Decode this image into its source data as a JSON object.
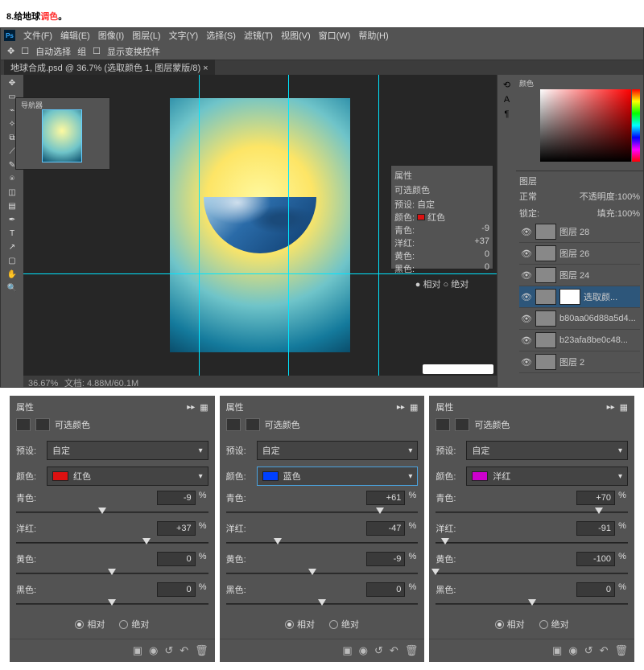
{
  "title": {
    "num": "8.",
    "text": "给地球",
    "red": "调色",
    "dot": "。"
  },
  "menu": [
    "文件(F)",
    "编辑(E)",
    "图像(I)",
    "图层(L)",
    "文字(Y)",
    "选择(S)",
    "滤镜(T)",
    "视图(V)",
    "窗口(W)",
    "帮助(H)"
  ],
  "optbar": {
    "tool": "自动选择",
    "group": "组",
    "checkbox": "显示变换控件"
  },
  "doc_tab": "地球合成.psd @ 36.7% (选取颜色 1, 图层蒙版/8) ×",
  "status": {
    "zoom": "36.67%",
    "info": "文档: 4.88M/60.1M"
  },
  "nav_title": "导航器",
  "float": {
    "title": "属性",
    "type": "可选颜色",
    "preset_l": "预设:",
    "preset_v": "自定",
    "color_l": "颜色:",
    "color_v": "红色",
    "rows": [
      {
        "l": "青色:",
        "v": "-9"
      },
      {
        "l": "洋红:",
        "v": "+37"
      },
      {
        "l": "黄色:",
        "v": "0"
      },
      {
        "l": "黑色:",
        "v": "0"
      }
    ],
    "rel": "相对",
    "abs": "绝对"
  },
  "color_tab": "颜色",
  "layers": {
    "tab": "图层",
    "kind": "正常",
    "opacity_l": "不透明度:",
    "opacity_v": "100%",
    "lock_l": "锁定:",
    "fill_l": "填充:",
    "fill_v": "100%",
    "items": [
      {
        "name": "图层 28"
      },
      {
        "name": "图层 26"
      },
      {
        "name": "图层 24"
      },
      {
        "name": "选取颜..."
      },
      {
        "name": ""
      },
      {
        "name": "b80aa06d88a5d4..."
      },
      {
        "name": "b23afa8be0c48..."
      },
      {
        "name": "图层 2"
      }
    ]
  },
  "panels": [
    {
      "title": "属性",
      "type": "可选颜色",
      "preset_l": "预设:",
      "preset_v": "自定",
      "color_l": "颜色:",
      "color_v": "红色",
      "color_hex": "#d11",
      "sliders": [
        {
          "l": "青色:",
          "v": "-9",
          "pos": 45
        },
        {
          "l": "洋红:",
          "v": "+37",
          "pos": 68
        },
        {
          "l": "黄色:",
          "v": "0",
          "pos": 50
        },
        {
          "l": "黑色:",
          "v": "0",
          "pos": 50
        }
      ],
      "rel": "相对",
      "abs": "绝对"
    },
    {
      "title": "属性",
      "type": "可选颜色",
      "preset_l": "预设:",
      "preset_v": "自定",
      "color_l": "颜色:",
      "color_v": "蓝色",
      "color_hex": "#0040ff",
      "sliders": [
        {
          "l": "青色:",
          "v": "+61",
          "pos": 80
        },
        {
          "l": "洋红:",
          "v": "-47",
          "pos": 27
        },
        {
          "l": "黄色:",
          "v": "-9",
          "pos": 45
        },
        {
          "l": "黑色:",
          "v": "0",
          "pos": 50
        }
      ],
      "rel": "相对",
      "abs": "绝对"
    },
    {
      "title": "属性",
      "type": "可选颜色",
      "preset_l": "预设:",
      "preset_v": "自定",
      "color_l": "颜色:",
      "color_v": "洋红",
      "color_hex": "#cc00cc",
      "sliders": [
        {
          "l": "青色:",
          "v": "+70",
          "pos": 85
        },
        {
          "l": "洋红:",
          "v": "-91",
          "pos": 5
        },
        {
          "l": "黄色:",
          "v": "-100",
          "pos": 0
        },
        {
          "l": "黑色:",
          "v": "0",
          "pos": 50
        }
      ],
      "rel": "相对",
      "abs": "绝对"
    }
  ],
  "pct": "%"
}
